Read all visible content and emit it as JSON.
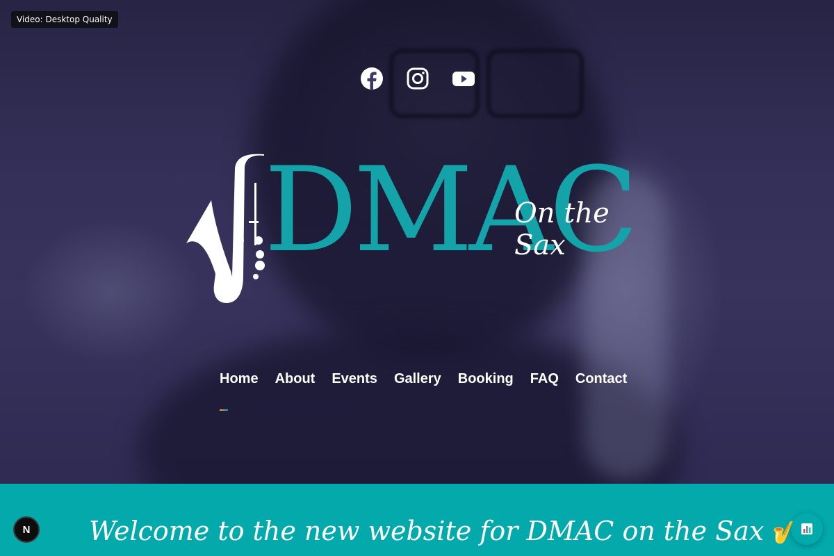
{
  "video_badge": "Video: Desktop Quality",
  "social": [
    {
      "name": "facebook-icon",
      "label": "Facebook"
    },
    {
      "name": "instagram-icon",
      "label": "Instagram"
    },
    {
      "name": "youtube-icon",
      "label": "YouTube"
    }
  ],
  "logo": {
    "letters": "DMAC",
    "tagline": "On the Sax"
  },
  "nav": {
    "items": [
      "Home",
      "About",
      "Events",
      "Gallery",
      "Booking",
      "FAQ",
      "Contact"
    ],
    "active": "Home"
  },
  "banner": {
    "welcome_text": "Welcome to the new website for DMAC on the Sax",
    "emoji": "🎷"
  },
  "floating": {
    "left_button": "N",
    "right_button_icon": "chart-icon"
  },
  "colors": {
    "teal": "#03a9ab",
    "logo_teal": "#14a3a8",
    "hero_bg": "#3a3560"
  }
}
